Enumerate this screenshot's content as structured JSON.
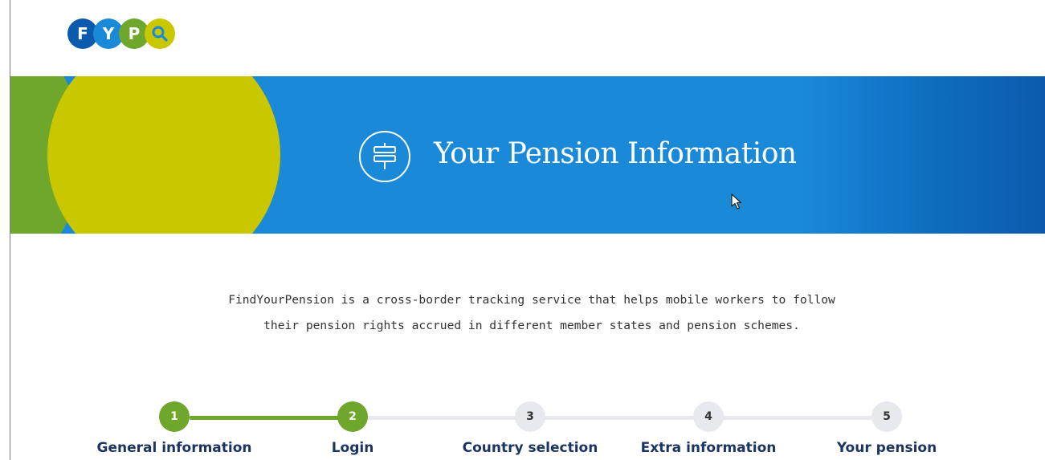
{
  "logo": {
    "letters": [
      "F",
      "Y",
      "P"
    ],
    "icon": "magnifier-icon",
    "colors": [
      "#0b5aad",
      "#1a8ad8",
      "#6ea72c",
      "#c9c700"
    ]
  },
  "hero": {
    "title": "Your Pension Information",
    "icon": "signpost-icon",
    "colors": {
      "background": "#1a8ad8",
      "green": "#6ea72c",
      "yellow": "#c9c700"
    }
  },
  "intro": {
    "line1": "FindYourPension is a cross-border tracking service that helps mobile workers to follow",
    "line2": "their pension rights accrued in different member states and pension schemes."
  },
  "stepper": {
    "steps": [
      {
        "number": "1",
        "label": "General information",
        "state": "done"
      },
      {
        "number": "2",
        "label": "Login",
        "state": "done"
      },
      {
        "number": "3",
        "label": "Country selection",
        "state": "todo"
      },
      {
        "number": "4",
        "label": "Extra information",
        "state": "todo"
      },
      {
        "number": "5",
        "label": "Your pension",
        "state": "todo"
      }
    ],
    "colors": {
      "done": "#6ea72c",
      "todo": "#e8e9ee",
      "label": "#1c3560"
    }
  }
}
